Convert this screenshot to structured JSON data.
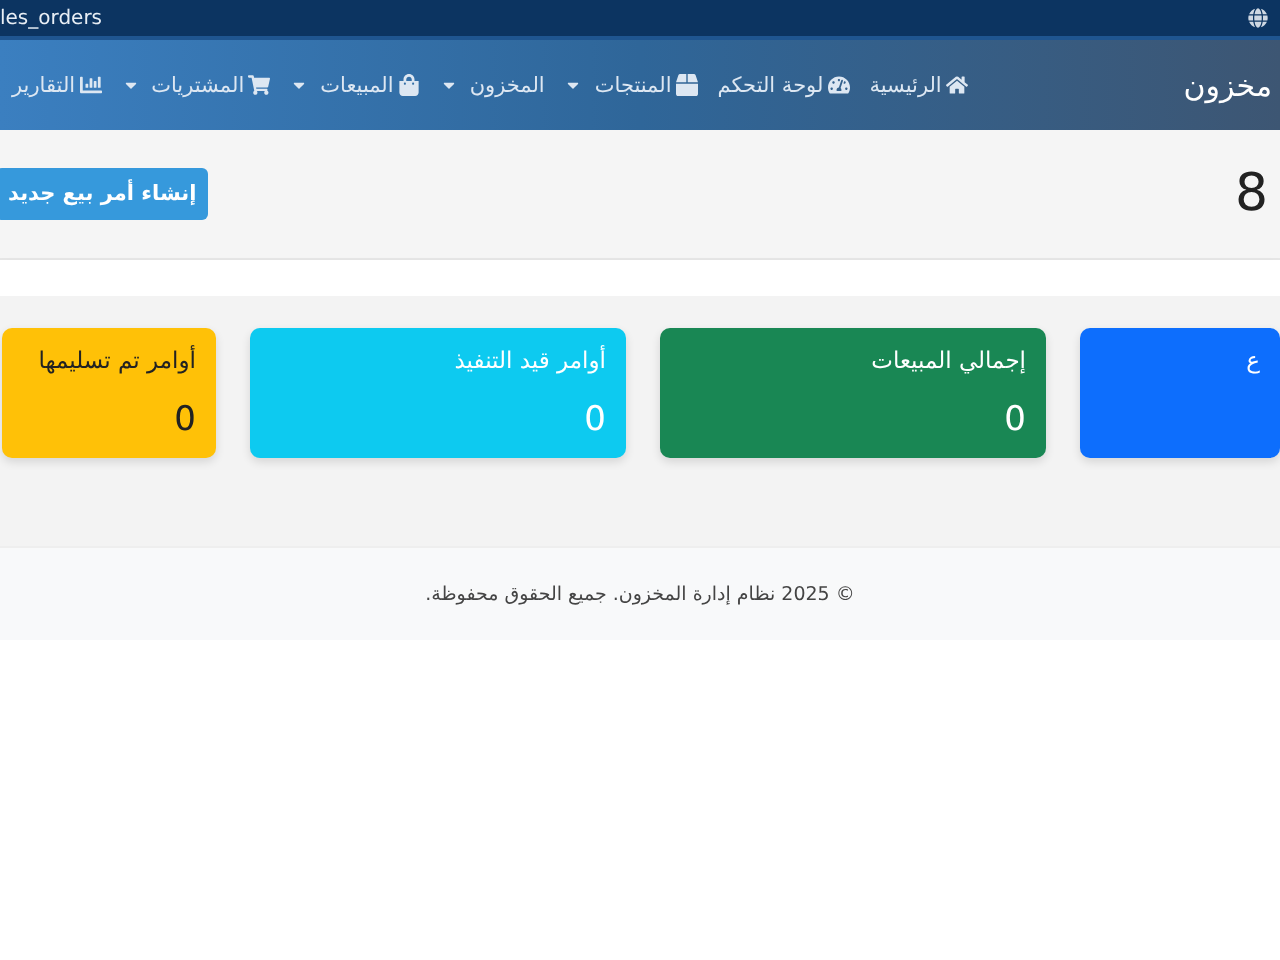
{
  "top_bar": {
    "title": "les_orders"
  },
  "navbar": {
    "brand": "مخزون",
    "items": [
      {
        "label": "الرئيسية",
        "dropdown": false
      },
      {
        "label": "لوحة التحكم",
        "dropdown": false
      },
      {
        "label": "المنتجات",
        "dropdown": true
      },
      {
        "label": "المخزون",
        "dropdown": true
      },
      {
        "label": "المبيعات",
        "dropdown": true
      },
      {
        "label": "المشتريات",
        "dropdown": true
      },
      {
        "label": "التقارير",
        "dropdown": false
      }
    ]
  },
  "header": {
    "heading": "8",
    "button": "إنشاء أمر بيع جديد"
  },
  "stat_cards": [
    {
      "title": "ع",
      "color": "#0d6efd"
    },
    {
      "title": "إجمالي المبيعات",
      "value": "0",
      "color": "#198754"
    },
    {
      "title": "أوامر قيد التنفيذ",
      "value": "0",
      "color": "#0dcaf0"
    },
    {
      "title": "أوامر تم تسليمها",
      "value": "0",
      "color": "#ffc107"
    }
  ],
  "footer": {
    "text": "© 2025 نظام إدارة المخزون. جميع الحقوق محفوظة."
  }
}
